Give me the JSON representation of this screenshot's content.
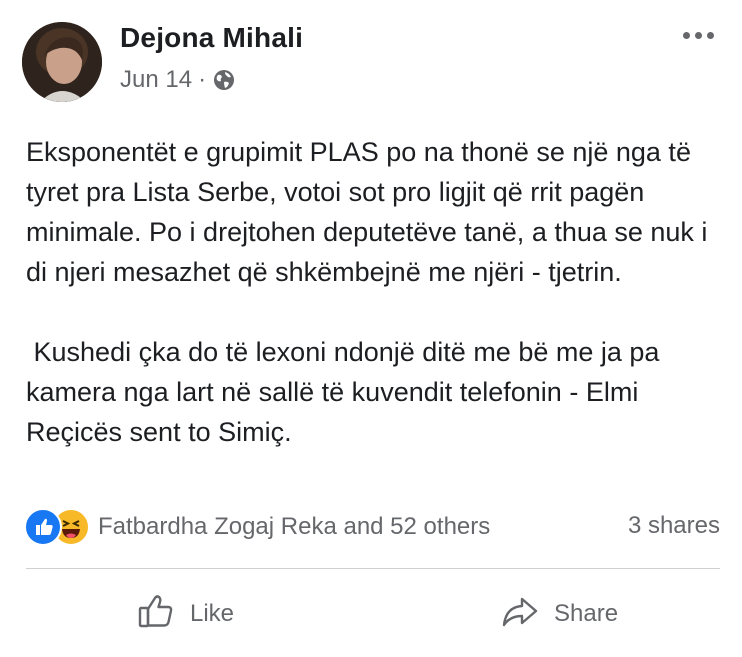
{
  "post": {
    "author": "Dejona Mihali",
    "date": "Jun 14",
    "separator": "·",
    "privacy_icon": "globe-icon",
    "paragraphs": [
      "Eksponentët e grupimit PLAS po na thonë se një nga të tyret pra Lista Serbe, votoi sot pro ligjit që rrit pagën minimale. Po i drejtohen deputetëve tanë, a thua se nuk i di njeri mesazhet që shkëmbejnë me njëri - tjetrin.",
      " Kushedi çka do të lexoni ndonjë ditë me bë me ja pa kamera nga lart në sallë të kuvendit telefonin - Elmi Reçicës sent to Simiç."
    ]
  },
  "reactions": {
    "icons": [
      "like-reaction-icon",
      "haha-reaction-icon"
    ],
    "summary": "Fatbardha Zogaj Reka and 52 others",
    "shares": "3 shares"
  },
  "actions": {
    "like_label": "Like",
    "share_label": "Share"
  },
  "colors": {
    "text": "#1c1e21",
    "secondary": "#65676b",
    "like_blue": "#1877f2",
    "haha_yellow": "#f7b928",
    "divider": "#ced0d4"
  }
}
